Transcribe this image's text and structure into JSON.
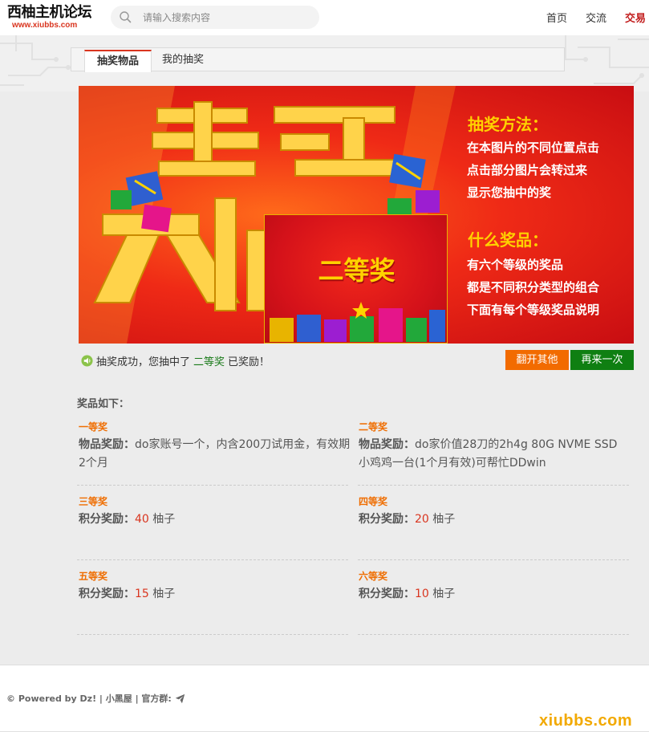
{
  "header": {
    "logo_title": "西柚主机论坛",
    "logo_url": "www.xiubbs.com",
    "search_placeholder": "请输入搜索内容",
    "nav": [
      "首页",
      "交流",
      "交易"
    ]
  },
  "tabs": [
    "抽奖物品",
    "我的抽奖"
  ],
  "banner": {
    "method_title": "抽奖方法：",
    "method_lines": [
      "在本图片的不同位置点击",
      "点击部分图片会转过来",
      "显示您抽中的奖"
    ],
    "prize_title": "什么奖品：",
    "prize_lines": [
      "有六个等级的奖品",
      "都是不同积分类型的组合",
      "下面有每个等级奖品说明"
    ],
    "revealed_prize": "二等奖",
    "colors": {
      "yellow": "#ffd200",
      "red": "#e8231a"
    }
  },
  "result": {
    "prefix": "抽奖成功，您抽中了",
    "prize": "二等奖",
    "suffix": "已奖励！",
    "btn_flip": "翻开其他",
    "btn_again": "再来一次"
  },
  "list": {
    "title": "奖品如下：",
    "items": [
      {
        "level": "一等奖",
        "label": "物品奖励：",
        "text": "do家账号一个，内含200刀试用金，有效期2个月"
      },
      {
        "level": "二等奖",
        "label": "物品奖励：",
        "text": "do家价值28刀的2h4g 80G NVME SSD 小鸡鸡一台(1个月有效)可帮忙DDwin"
      },
      {
        "level": "三等奖",
        "label": "积分奖励：",
        "num": "40",
        "unit": "柚子"
      },
      {
        "level": "四等奖",
        "label": "积分奖励：",
        "num": "20",
        "unit": "柚子"
      },
      {
        "level": "五等奖",
        "label": "积分奖励：",
        "num": "15",
        "unit": "柚子"
      },
      {
        "level": "六等奖",
        "label": "积分奖励：",
        "num": "10",
        "unit": "柚子"
      }
    ]
  },
  "footer": {
    "text": "© Powered by Dz! | 小黑屋 | 官方群:",
    "watermark": "xiubbs.com"
  }
}
